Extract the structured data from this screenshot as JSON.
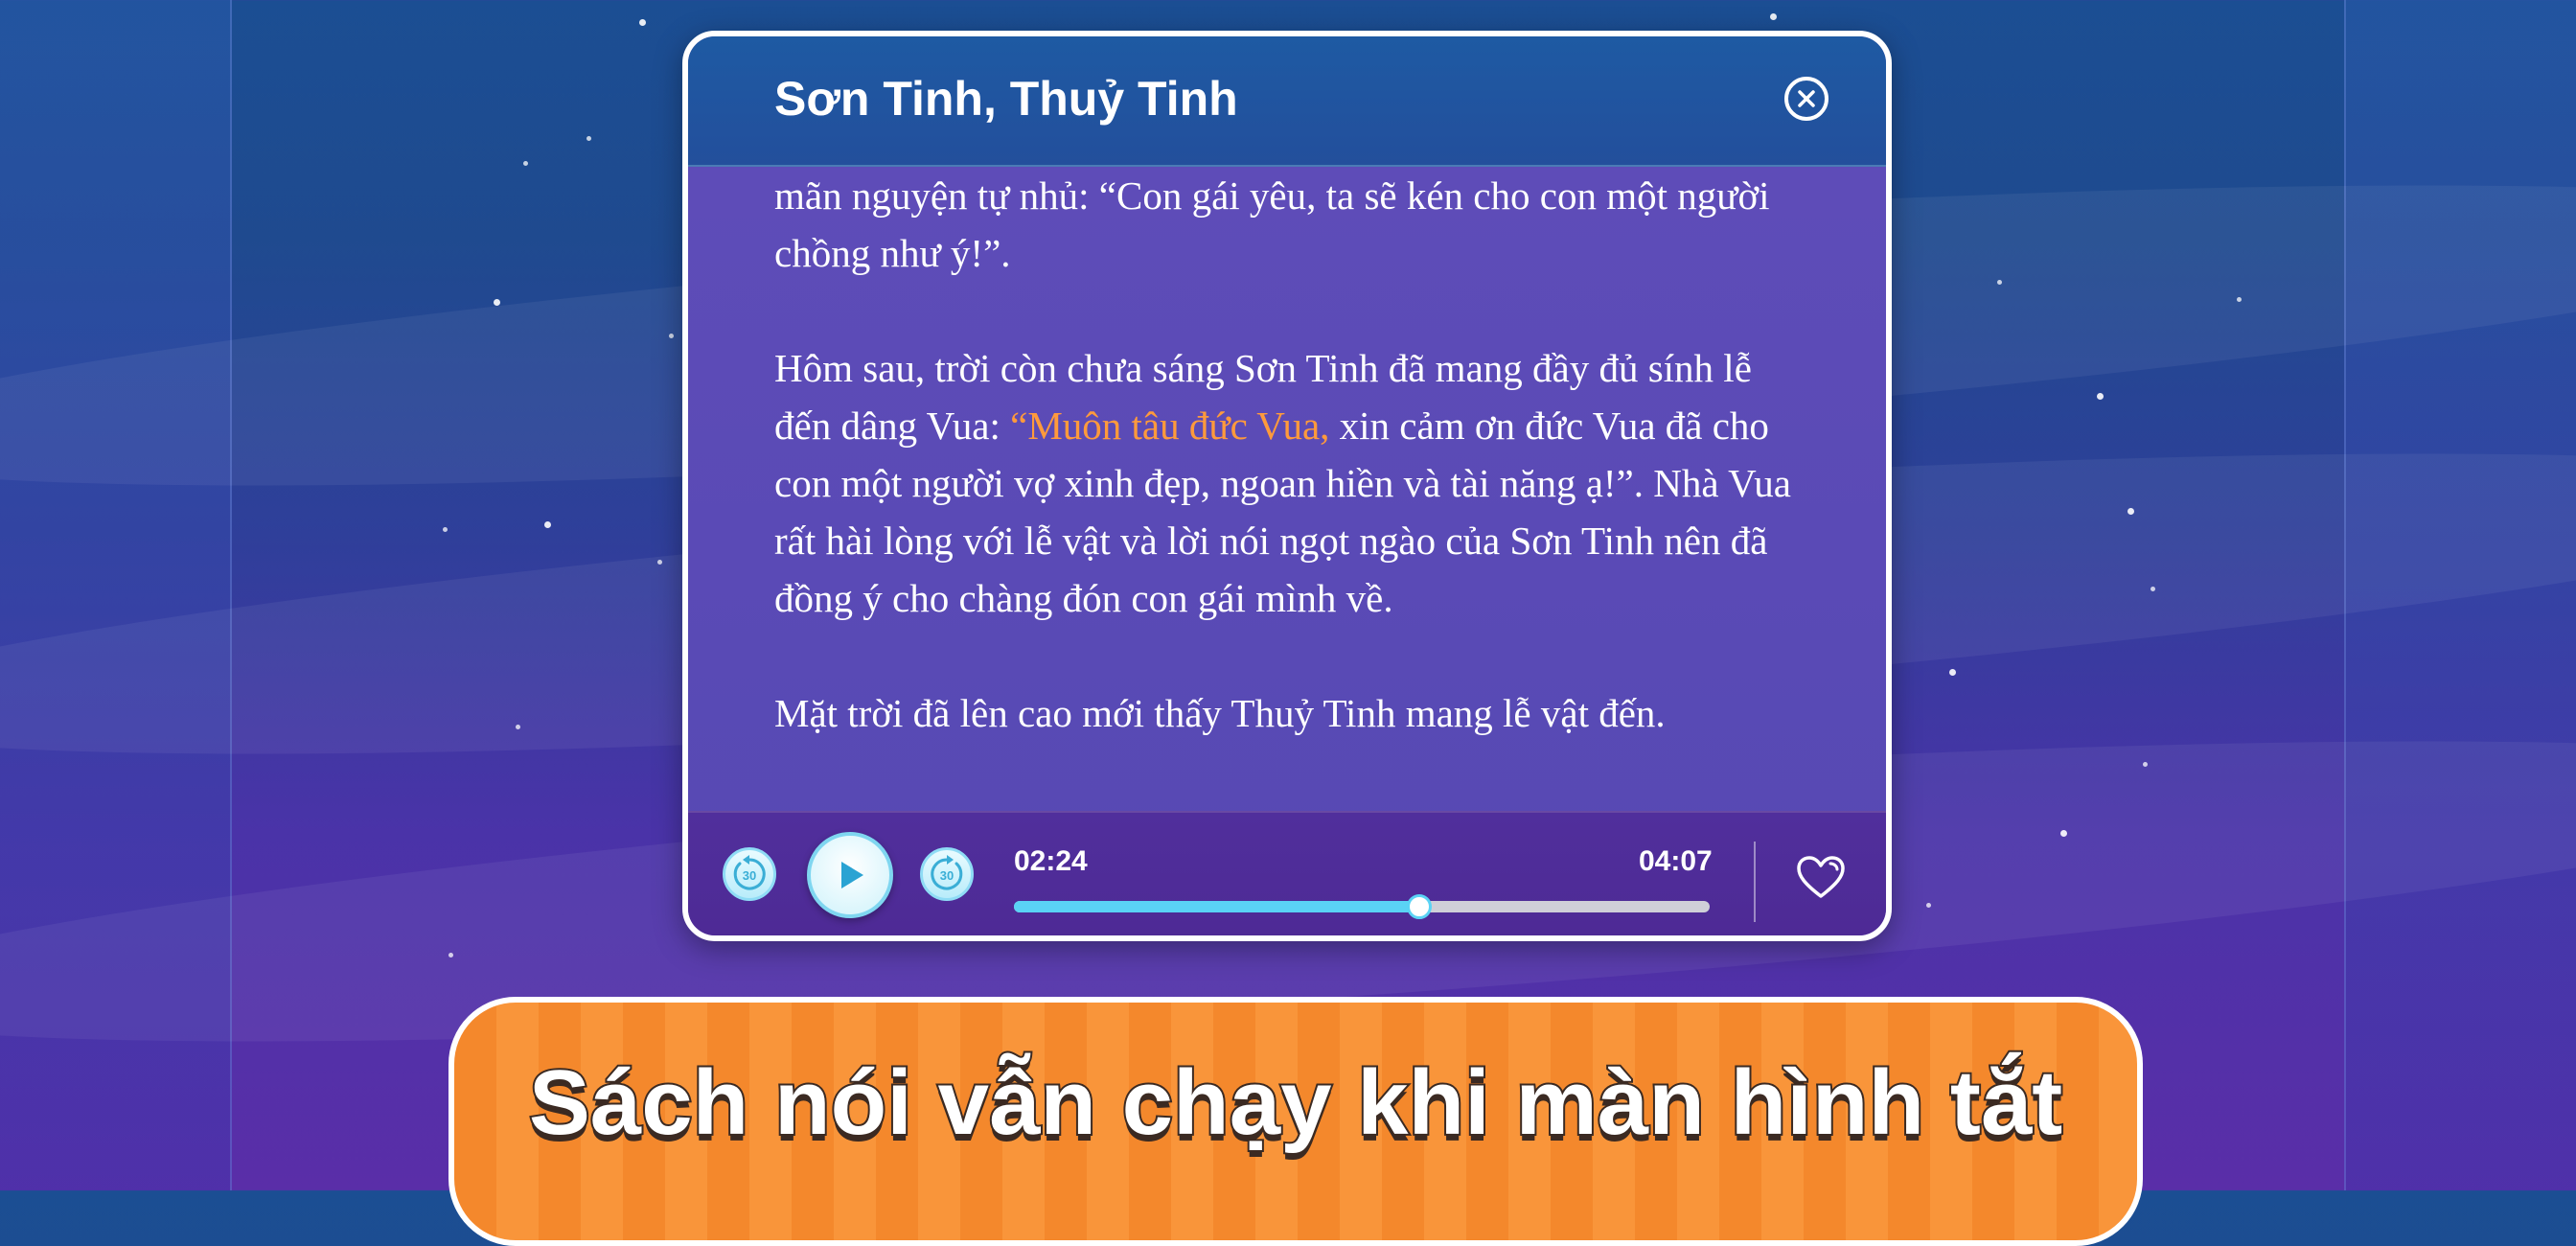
{
  "dialog": {
    "title": "Sơn Tinh, Thuỷ Tinh",
    "close_icon": "close-circle-icon",
    "paragraphs": [
      {
        "text": "mãn nguyện tự nhủ: “Con gái yêu, ta sẽ kén cho con một người chồng như ý!”."
      },
      {
        "before": "Hôm sau, trời còn chưa sáng Sơn Tinh đã mang đầy đủ sính lễ đến dâng Vua: ",
        "highlight": "“Muôn tâu đức Vua,",
        "after": " xin cảm ơn đức Vua đã cho con một người vợ xinh đẹp, ngoan hiền và tài năng ạ!”. Nhà Vua rất hài lòng với lễ vật và lời nói ngọt ngào của Sơn Tinh nên đã đồng ý cho chàng đón con gái mình về."
      },
      {
        "text": "Mặt trời đã lên cao mới thấy Thuỷ Tinh mang lễ vật đến."
      }
    ],
    "highlight_color": "#ff9a3c"
  },
  "player": {
    "rewind_label": "30",
    "forward_label": "30",
    "elapsed": "02:24",
    "duration": "04:07",
    "progress": 0.583,
    "play_icon": "play-icon",
    "favorite_icon": "heart-icon",
    "accent_color": "#5ad3f5"
  },
  "banner": {
    "text": "Sách nói vẫn chạy khi màn hình tắt",
    "color": "#f4882c"
  }
}
